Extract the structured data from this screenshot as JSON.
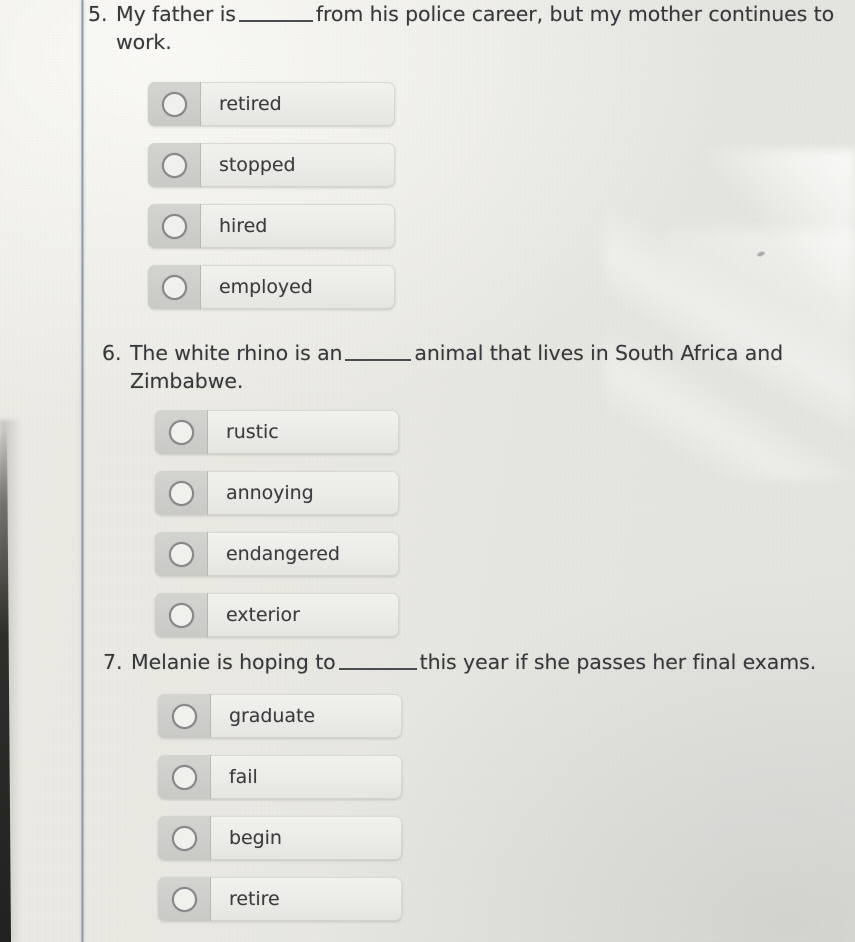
{
  "page": {
    "type": "printed-worksheet-photo",
    "background_color": "#e9e8e2",
    "margin_rule_color": "#687e92",
    "text_color": "#36383a",
    "option_fill_color": "#ebebe7",
    "radio_cell_color": "#cdcec9"
  },
  "questions": [
    {
      "number": "5.",
      "text_before": "My father is",
      "text_after": "from his police career, but my mother continues to work.",
      "blank": "__________",
      "options": [
        {
          "label": "retired",
          "selected": false
        },
        {
          "label": "stopped",
          "selected": false
        },
        {
          "label": "hired",
          "selected": false
        },
        {
          "label": "employed",
          "selected": false
        }
      ]
    },
    {
      "number": "6.",
      "text_before": "The white rhino is an",
      "text_after": "animal that lives in South Africa and Zimbabwe.",
      "blank": "__________",
      "options": [
        {
          "label": "rustic",
          "selected": false
        },
        {
          "label": "annoying",
          "selected": false
        },
        {
          "label": "endangered",
          "selected": false
        },
        {
          "label": "exterior",
          "selected": false
        }
      ]
    },
    {
      "number": "7.",
      "text_before": "Melanie is hoping to",
      "text_after": "this year if she passes her final exams.",
      "blank": "__________",
      "options": [
        {
          "label": "graduate",
          "selected": false
        },
        {
          "label": "fail",
          "selected": false
        },
        {
          "label": "begin",
          "selected": false
        },
        {
          "label": "retire",
          "selected": false
        }
      ]
    }
  ],
  "icons": {
    "radio": "radio-button-unselected"
  }
}
